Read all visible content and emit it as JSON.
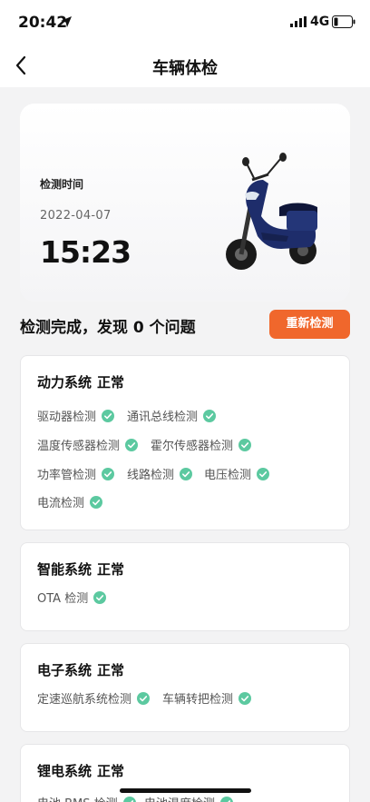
{
  "status_bar": {
    "time": "20:42",
    "network": "4G"
  },
  "nav": {
    "title": "车辆体检"
  },
  "hero": {
    "label": "检测时间",
    "date": "2022-04-07",
    "time": "15:23"
  },
  "summary": {
    "text": "检测完成，发现 0 个问题",
    "button": "重新检测"
  },
  "systems": [
    {
      "name": "动力系统",
      "status": "正常",
      "items": [
        "驱动器检测",
        "通讯总线检测",
        "温度传感器检测",
        "霍尔传感器检测",
        "功率管检测",
        "线路检测",
        "电压检测",
        "电流检测"
      ]
    },
    {
      "name": "智能系统",
      "status": "正常",
      "items": [
        "OTA 检测"
      ]
    },
    {
      "name": "电子系统",
      "status": "正常",
      "items": [
        "定速巡航系统检测",
        "车辆转把检测"
      ]
    },
    {
      "name": "锂电系统",
      "status": "正常",
      "items": [
        "电池 BMS 检测",
        "电池温度检测"
      ]
    }
  ],
  "colors": {
    "accent": "#f0672c",
    "check": "#5cc9a0",
    "scooter": "#1e2d6b"
  },
  "icons": [
    "location-arrow-icon",
    "signal-icon",
    "battery-icon",
    "back-chevron-icon",
    "check-circle-icon"
  ]
}
